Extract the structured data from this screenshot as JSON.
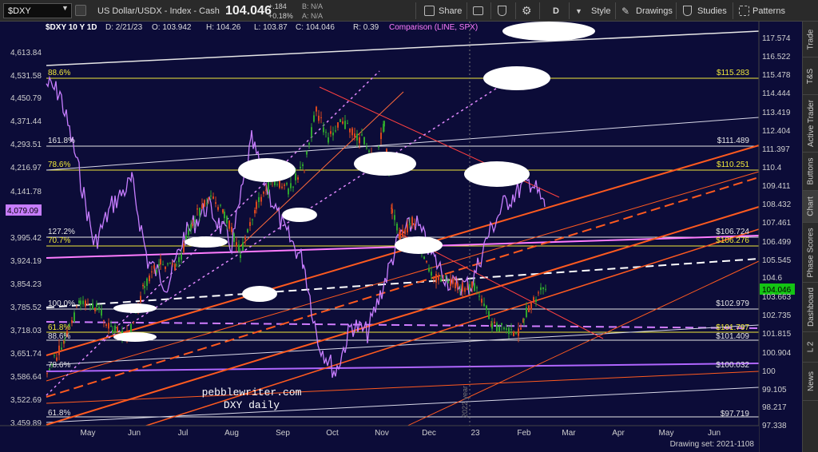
{
  "toolbar": {
    "symbol": "$DXY",
    "description": "US Dollar/USDX - Index - Cash",
    "change": "+.184",
    "change_pct": "+0.18%",
    "bid": "B: N/A",
    "ask": "A: N/A",
    "last": "104.046",
    "share_label": "Share",
    "timeframe_label": "D",
    "style_label": "Style",
    "drawings_label": "Drawings",
    "studies_label": "Studies",
    "patterns_label": "Patterns",
    "icons": [
      "link-icon",
      "share-icon",
      "window-icon",
      "flask-icon",
      "gear-icon",
      "chevron-down-icon",
      "pencil-icon",
      "flask-icon",
      "grid-icon"
    ]
  },
  "chart_header": {
    "title": "$DXY 10 Y 1D",
    "date": "D: 2/21/23",
    "open": "O: 103.942",
    "high": "H: 104.26",
    "low": "L: 103.87",
    "close": "C: 104.046",
    "range": "R: 0.39",
    "comparison": "Comparison (LINE, SPX)"
  },
  "sidebar_tabs": [
    "Trade",
    "T&S",
    "Active Trader",
    "Buttons",
    "Chart",
    "Phase Scores",
    "Dashboard",
    "L 2",
    "News"
  ],
  "left_axis_labels": [
    "4,613.84",
    "4,531.58",
    "4,450.79",
    "4,371.44",
    "4,293.51",
    "4,216.97",
    "4,141.78",
    "4,079.09",
    "3,995.42",
    "3,924.19",
    "3,854.23",
    "3,785.52",
    "3,718.03",
    "3,651.74",
    "3,586.64",
    "3,522.69",
    "3,459.89"
  ],
  "right_axis_labels": [
    "117.574",
    "116.522",
    "115.478",
    "114.444",
    "113.419",
    "112.404",
    "111.397",
    "110.4",
    "109.411",
    "108.432",
    "107.461",
    "106.499",
    "105.545",
    "104.6",
    "104.046",
    "103.663",
    "102.735",
    "101.815",
    "100.904",
    "100",
    "99.105",
    "98.217",
    "97.338"
  ],
  "x_axis_labels": [
    "May",
    "Jun",
    "Jul",
    "Aug",
    "Sep",
    "Oct",
    "Nov",
    "Dec",
    "23",
    "Feb",
    "Mar",
    "Apr",
    "May",
    "Jun"
  ],
  "fib_left_labels": [
    "88.6%",
    "161.8%",
    "78.6%",
    "127.2%",
    "70.7%",
    "100.0%",
    "61.8%",
    "88.6%",
    "78.6%",
    "61.8%"
  ],
  "price_tags": [
    "$115.283",
    "$111.489",
    "$110.251",
    "$106.724",
    "$106.276",
    "$102.979",
    "$101.797",
    "$101.409",
    "$100.032",
    "$97.719"
  ],
  "watermark": [
    "pebblewriter.com",
    "DXY daily"
  ],
  "year_marker": "2022 year",
  "drawing_set": "Drawing set: 2021-1108",
  "colors": {
    "background": "#0c0c38",
    "candle_up": "#2ea52e",
    "candle_down": "#d8471e",
    "spx_line": "#c77dff",
    "fib_yellow": "#f2e93a",
    "channel_orange": "#ff5a1f",
    "last_tag": "#14c414",
    "spx_tag": "#c77dff"
  }
}
